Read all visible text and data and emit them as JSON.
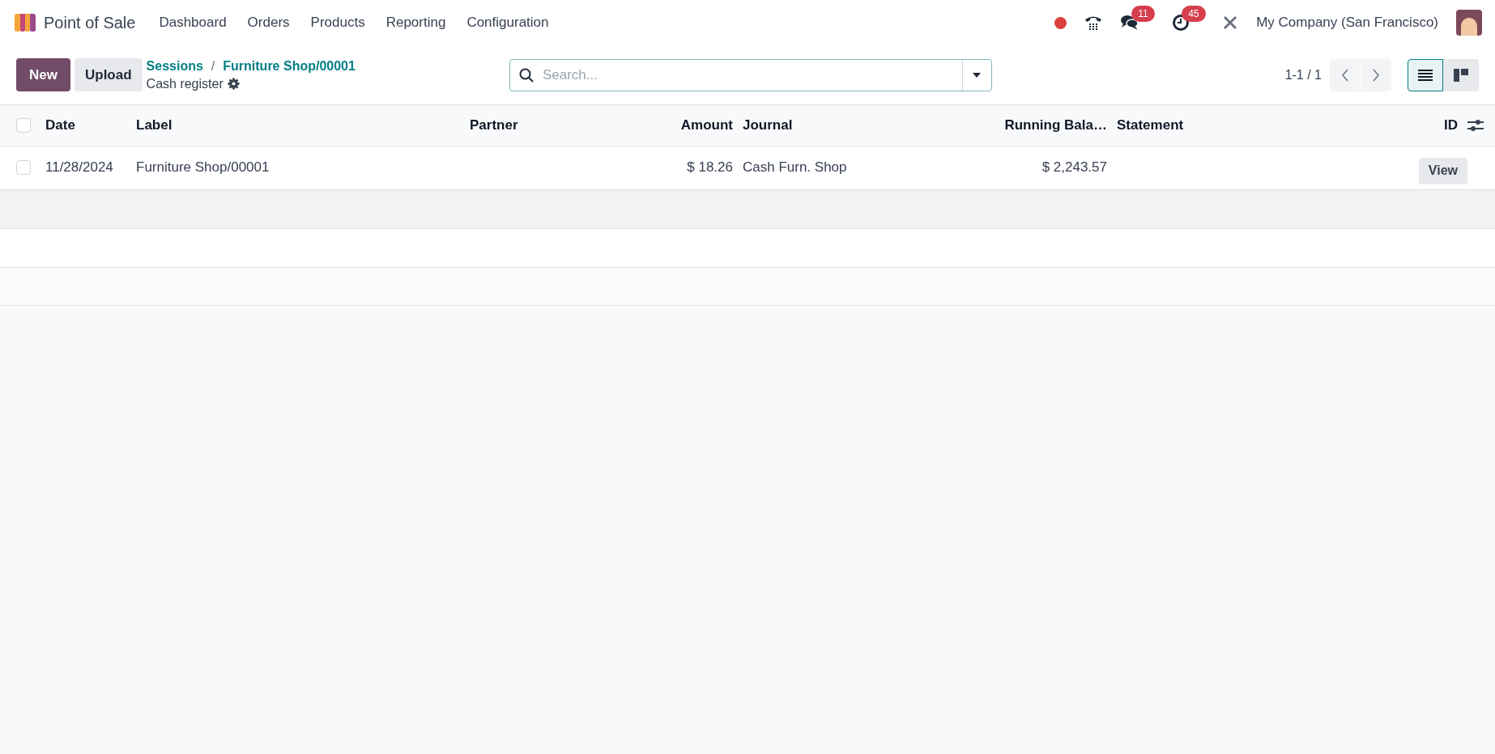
{
  "navbar": {
    "app_name": "Point of Sale",
    "menu": [
      "Dashboard",
      "Orders",
      "Products",
      "Reporting",
      "Configuration"
    ],
    "messages_count": "11",
    "activities_count": "45",
    "company": "My Company (San Francisco)"
  },
  "control_panel": {
    "buttons": [
      "New",
      "Upload"
    ],
    "breadcrumbs": [
      "Sessions",
      "Furniture Shop/00001"
    ],
    "breadcrumb_separator": "/",
    "title": "Cash register",
    "search": {
      "placeholder": "Search..."
    },
    "pager": "1-1 / 1",
    "views": [
      {
        "kind": "list",
        "selected": true
      },
      {
        "kind": "kanban",
        "selected": false
      }
    ]
  },
  "table": {
    "select_all_checked": false,
    "columns": [
      {
        "label": "Date",
        "kind": "text"
      },
      {
        "label": "Label",
        "kind": "text"
      },
      {
        "label": "Partner",
        "kind": "text"
      },
      {
        "label": "Amount",
        "kind": "number"
      },
      {
        "label": "Journal",
        "kind": "text"
      },
      {
        "label": "Running Bala…",
        "kind": "number"
      },
      {
        "label": "Statement",
        "kind": "text"
      },
      {
        "label": "ID",
        "kind": "number"
      }
    ],
    "rows": [
      {
        "checked": false,
        "cells": [
          "11/28/2024",
          "Furniture Shop/00001",
          "",
          "$ 18.26",
          "Cash Furn. Shop",
          "$ 2,243.57",
          ""
        ],
        "action": "View"
      }
    ]
  }
}
